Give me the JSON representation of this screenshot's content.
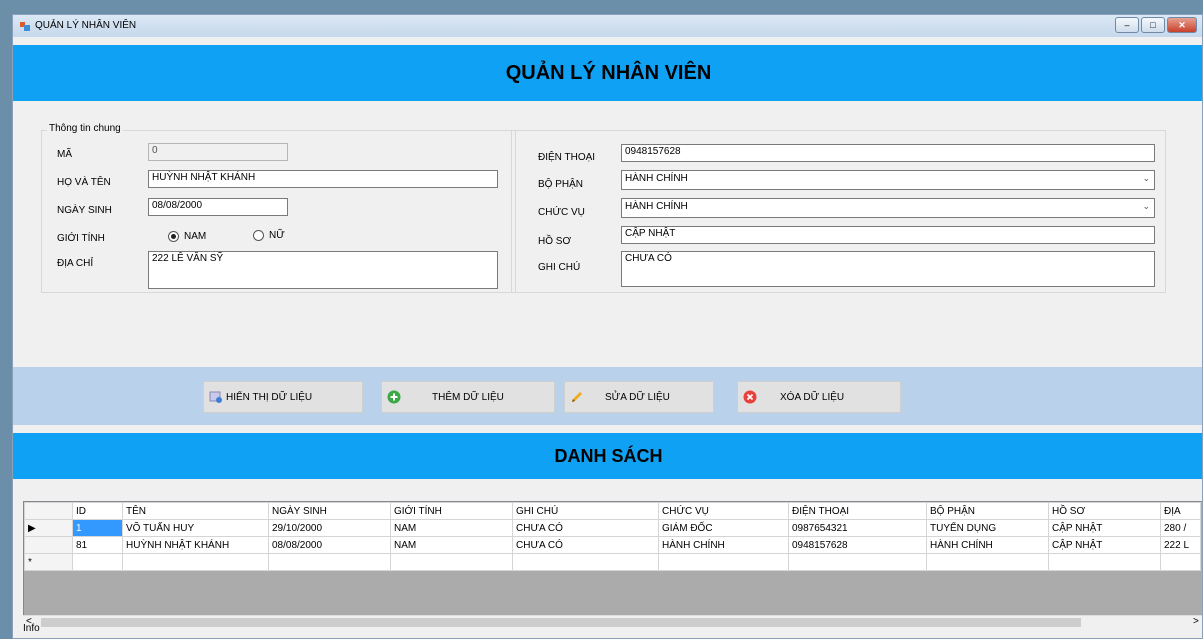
{
  "window": {
    "title": "QUẢN LÝ NHÂN VIÊN",
    "min_label": "–",
    "max_label": "□",
    "close_label": "✕"
  },
  "header": {
    "title": "QUẢN LÝ NHÂN VIÊN"
  },
  "info_group": {
    "legend": "Thông tin chung",
    "ma_label": "MÃ",
    "ma_value": "0",
    "ho_ten_label": "HỌ VÀ TÊN",
    "ho_ten_value": "HUỲNH NHẬT KHÁNH",
    "ngay_sinh_label": "NGÀY SINH",
    "ngay_sinh_value": "08/08/2000",
    "gioi_tinh_label": "GIỚI TÍNH",
    "nam_label": "NAM",
    "nu_label": "NỮ",
    "selected_gender": "NAM",
    "dia_chi_label": "ĐỊA CHỈ",
    "dia_chi_value": "222 LÊ VĂN SỸ"
  },
  "right_group": {
    "dien_thoai_label": "ĐIỆN THOẠI",
    "dien_thoai_value": "0948157628",
    "bo_phan_label": "BỘ PHẬN",
    "bo_phan_value": "HÀNH CHÍNH",
    "chuc_vu_label": "CHỨC VỤ",
    "chuc_vu_value": "HÀNH CHÍNH",
    "ho_so_label": "HỒ SƠ",
    "ho_so_value": "CẬP NHẬT",
    "ghi_chu_label": "GHI CHÚ",
    "ghi_chu_value": "CHƯA CÓ"
  },
  "toolbar": {
    "show_label": "HIỂN THỊ DỮ LIỆU",
    "add_label": "THÊM DỮ LIỆU",
    "edit_label": "SỬA DỮ LIỆU",
    "delete_label": "XÓA DỮ LIỆU"
  },
  "list_header": {
    "title": "DANH SÁCH"
  },
  "table": {
    "columns": [
      "ID",
      "TÊN",
      "NGÀY SINH",
      "GIỚI TÍNH",
      "GHI CHÚ",
      "CHỨC VỤ",
      "ĐIỆN THOẠI",
      "BỘ PHẬN",
      "HỒ SƠ",
      "ĐỊA"
    ],
    "rows": [
      [
        "1",
        "VÕ TUẤN HUY",
        "29/10/2000",
        "NAM",
        "CHƯA CÓ",
        "GIÁM ĐỐC",
        "0987654321",
        "TUYỂN DỤNG",
        "CẬP NHẬT",
        "280 /"
      ],
      [
        "81",
        "HUỲNH NHẬT KHÁNH",
        "08/08/2000",
        "NAM",
        "CHƯA CÓ",
        "HÀNH CHÍNH",
        "0948157628",
        "HÀNH CHÍNH",
        "CẬP NHẬT",
        "222 L"
      ]
    ],
    "current_row_marker": "▶",
    "new_row_marker": "*"
  },
  "scrollbar": {
    "left_arrow": "<",
    "right_arrow": ">"
  },
  "status": {
    "text": "Info"
  },
  "colors": {
    "banner": "#0fa1f3",
    "button_bar": "#b9d1ea",
    "window_bg": "#f0f0f0"
  }
}
